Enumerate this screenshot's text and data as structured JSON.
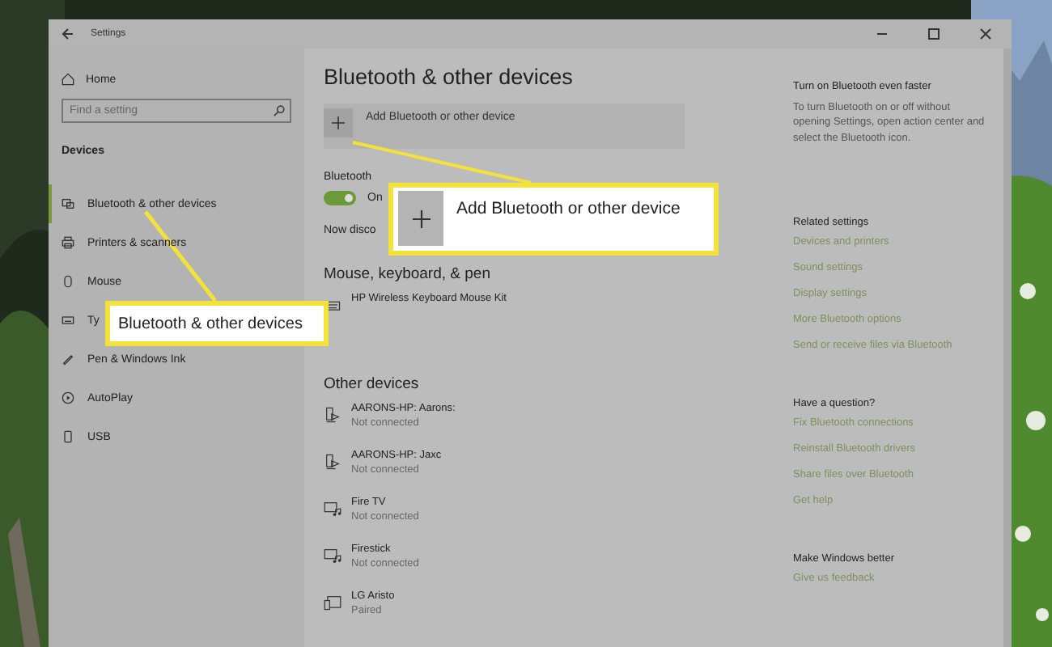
{
  "window": {
    "title": "Settings"
  },
  "sidebar": {
    "home": "Home",
    "search": {
      "placeholder": "Find a setting"
    },
    "section": "Devices",
    "items": [
      {
        "label": "Bluetooth & other devices",
        "kind": "bluetooth",
        "selected": true
      },
      {
        "label": "Printers & scanners",
        "kind": "printer",
        "selected": false
      },
      {
        "label": "Mouse",
        "kind": "mouse",
        "selected": false
      },
      {
        "label": "Ty",
        "kind": "keyboard",
        "selected": false
      },
      {
        "label": "Pen & Windows Ink",
        "kind": "pen",
        "selected": false
      },
      {
        "label": "AutoPlay",
        "kind": "autoplay",
        "selected": false
      },
      {
        "label": "USB",
        "kind": "usb",
        "selected": false
      }
    ]
  },
  "main": {
    "title": "Bluetooth & other devices",
    "add_button": "Add Bluetooth or other device",
    "bluetooth": {
      "label": "Bluetooth",
      "on": true,
      "state": "On"
    },
    "discoverable": "Now disco",
    "sections": [
      {
        "heading": "Mouse, keyboard, & pen",
        "devices": [
          {
            "name": "HP Wireless Keyboard Mouse Kit",
            "kind": "keyboard"
          }
        ]
      },
      {
        "heading": "Other devices",
        "devices": [
          {
            "name": "AARONS-HP: Aarons:",
            "status": "Not connected",
            "kind": "computer"
          },
          {
            "name": "AARONS-HP: Jaxc",
            "status": "Not connected",
            "kind": "computer"
          },
          {
            "name": "Fire TV",
            "status": "Not connected",
            "kind": "media"
          },
          {
            "name": "Firestick",
            "status": "Not connected",
            "kind": "media"
          },
          {
            "name": "LG Aristo",
            "status": "Paired",
            "kind": "phone"
          }
        ]
      }
    ]
  },
  "side_panel": [
    {
      "heading": "Turn on Bluetooth even faster",
      "text": "To turn Bluetooth on or off without opening Settings, open action center and select the Bluetooth icon."
    },
    {
      "heading": "Related settings",
      "links": [
        "Devices and printers",
        "Sound settings",
        "Display settings",
        "More Bluetooth options",
        "Send or receive files via Bluetooth"
      ]
    },
    {
      "heading": "Have a question?",
      "links": [
        "Fix Bluetooth connections",
        "Reinstall Bluetooth drivers",
        "Share files over Bluetooth",
        "Get help"
      ]
    },
    {
      "heading": "Make Windows better",
      "links": [
        "Give us feedback"
      ]
    }
  ],
  "callouts": [
    {
      "kind": "nav",
      "text": "Bluetooth & other devices"
    },
    {
      "kind": "add",
      "text": "Add Bluetooth or other device"
    }
  ]
}
